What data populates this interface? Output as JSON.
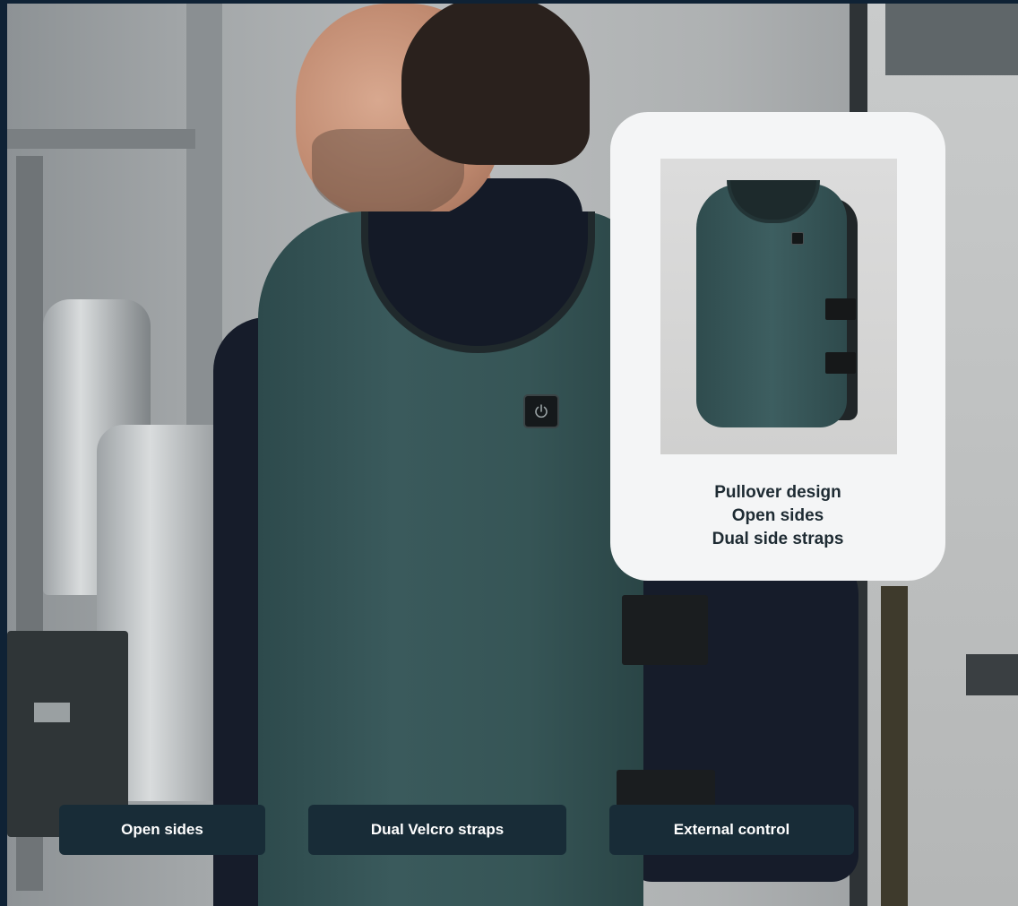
{
  "card": {
    "image_alt": "green vest product photo",
    "lines": [
      "Pullover design",
      "Open sides",
      "Dual side straps"
    ]
  },
  "labels": {
    "open_sides": "Open sides",
    "dual_velcro": "Dual Velcro straps",
    "external_control": "External control"
  },
  "icons": {
    "control": "power-icon"
  },
  "colors": {
    "frame": "#0f2235",
    "vest": "#3a5a5c",
    "label_bg": "#182c37",
    "card_bg": "#f4f5f6"
  }
}
